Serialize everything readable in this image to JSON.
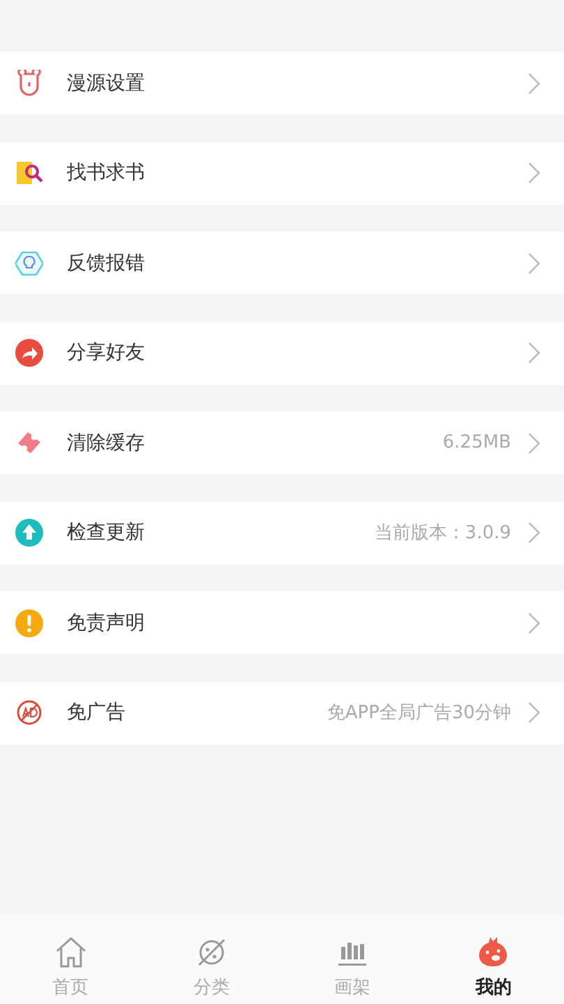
{
  "menu": [
    {
      "kind": "bear",
      "label": "漫源设置"
    },
    {
      "kind": "book-search",
      "label": "找书求书"
    },
    {
      "kind": "bulb",
      "label": "反馈报错"
    },
    {
      "kind": "share",
      "label": "分享好友"
    },
    {
      "kind": "ticket",
      "label": "清除缓存",
      "value": "6.25MB"
    },
    {
      "kind": "upload",
      "label": "检查更新",
      "value": "当前版本：3.0.9"
    },
    {
      "kind": "warning",
      "label": "免责声明"
    },
    {
      "kind": "ad",
      "label": "免广告",
      "value": "免APP全局广告30分钟"
    }
  ],
  "tabs": [
    {
      "kind": "home",
      "label": "首页",
      "selected": false
    },
    {
      "kind": "planet",
      "label": "分类",
      "selected": false
    },
    {
      "kind": "shelf",
      "label": "画架",
      "selected": false
    },
    {
      "kind": "mascot",
      "label": "我的",
      "selected": true
    }
  ]
}
